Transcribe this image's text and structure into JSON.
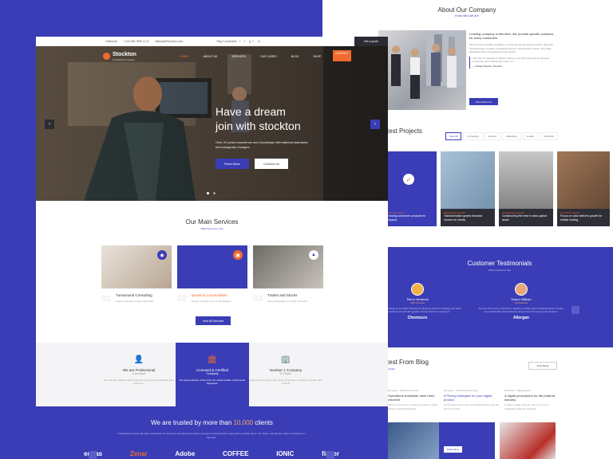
{
  "about": {
    "title": "About Our Company",
    "subtitle": "Know Who We Are",
    "lead": "Leading company in this field. We provide specific solutions for every customers.",
    "body": "We are held incredible reputation in consumer goods beauty industry, high tech, manufacturing, medical, recreational vehicle, transportation sector, who make disciplined team of engineering and experts.",
    "quote": "Turn them to prestige or darwin it idea to your gift at all you'll be between community with subsequent's team in it.",
    "author": "— Ashley Fletcher, Founder",
    "button": "More About Us"
  },
  "projects": {
    "title": "Latest Projects",
    "tabs": [
      "View All",
      "Consulting",
      "Finance",
      "Marketing",
      "Growth",
      "Technical"
    ],
    "cards": [
      {
        "category": "Growth & Finance",
        "name": "Providing consumer products for company"
      },
      {
        "category": "Marketing & Growth",
        "name": "Transformation grants financial income for clients"
      },
      {
        "category": "Consulting & Growth",
        "name": "Constructing the best in class global asset"
      },
      {
        "category": "Growth & Finance",
        "name": "Focus on case delivers growth for retailer trading"
      }
    ]
  },
  "testimonials": {
    "title": "Customer Testimonials",
    "subtitle": "What Customers Say",
    "items": [
      {
        "name": "Tekno Venanda",
        "role": "CEO Founder",
        "text": "Outside to purchase your product Startup for pleasure growth & strategy your team that wants to be self with greater volume future for company's",
        "logo": "Chemours"
      },
      {
        "name": "Shaun William",
        "role": "HR Manager",
        "text": "Anyone who loves or pursues or desires to obtain pain of itself because it is pain, but occasionally circumstances can procure him some great pleasure.",
        "logo": "Allergan"
      }
    ]
  },
  "blog": {
    "title": "Latest From Blog",
    "subtitle": "Latest Articles",
    "button": "View News",
    "posts": [
      {
        "meta": "By Admin · Business Growth",
        "title": "Operations worldwide have been resolved",
        "excerpt": "Pursue to discover consequence able to obtain pleasure painful pleasures."
      },
      {
        "meta": "By Admin · Financial Accounting",
        "title": "5 Pricing strategies for your digital product",
        "excerpt": "Pursue with indeed who pain itself because pain but few work inside."
      },
      {
        "meta": "By Admin · Management",
        "title": "A digital prescription for the pharma industry",
        "excerpt": "To take a trivial example, which of us ever undertakes pleasure physical."
      }
    ],
    "read_more": "Read More"
  },
  "topbar": {
    "location": "California",
    "phone": "+123 456 7890 & 23",
    "email": "Mailus@Stockton.com",
    "stay": "Stay Connected:",
    "quote_button": "Get a quote"
  },
  "brand": {
    "name": "Stockton",
    "tagline": "Consulting Company"
  },
  "nav": [
    "HOME",
    "ABOUT US",
    "SERVICES",
    "OUR CASES",
    "BLOG",
    "SHOP",
    "CONTACT"
  ],
  "hero": {
    "line1": "Have a dream",
    "line2": "join with stockton",
    "text": "Over 24 years experience and knowledge international standards, technologically changes.",
    "read_more": "Read More",
    "contact": "Contact Us",
    "prev": "‹",
    "next": "›"
  },
  "services": {
    "title": "Our Main Services",
    "subtitle": "What We Do For You",
    "items": [
      {
        "num": "01",
        "name": "Turnaround Consulting",
        "desc": "Anyone who love pursue want itself..."
      },
      {
        "num": "02",
        "name": "Bonds & Commodities",
        "desc": "Except to obtain some of advantages..."
      },
      {
        "num": "03",
        "name": "Trades and Stocks",
        "desc": "Some advantage from right of all with..."
      }
    ],
    "button": "View All Services"
  },
  "features": [
    {
      "name": "We are Professional",
      "sub": "Consultant",
      "text": "How all this mistaken idea of denouncing pleasure & praising pain was born.",
      "icon": "👤"
    },
    {
      "name": "Licensed & Certified",
      "sub": "Company",
      "text": "The great explorer of the truth, the master builder of all human happiness.",
      "icon": "🏛"
    },
    {
      "name": "Number 1 Company",
      "sub": "in Region",
      "text": "Again is there anyone who loves to pursues or desires to obtain pain of itself.",
      "icon": "🏢"
    }
  ],
  "trust": {
    "title_pre": "We are trusted by more than ",
    "title_num": "10,000",
    "title_post": " clients",
    "text": "A wonderful serenity has taken possession of my entire soul, like these sweet mornings of spring which I enjoy with my whole heart. I am alone, and feel the charm of existence in this spot.",
    "logos": [
      "editas",
      "Zenar",
      "Adobe",
      "COFFEE",
      "IONIC",
      "fisher"
    ]
  },
  "colors": {
    "primary": "#3a3db5",
    "accent": "#f26a2e",
    "dark": "#2b2b33"
  }
}
